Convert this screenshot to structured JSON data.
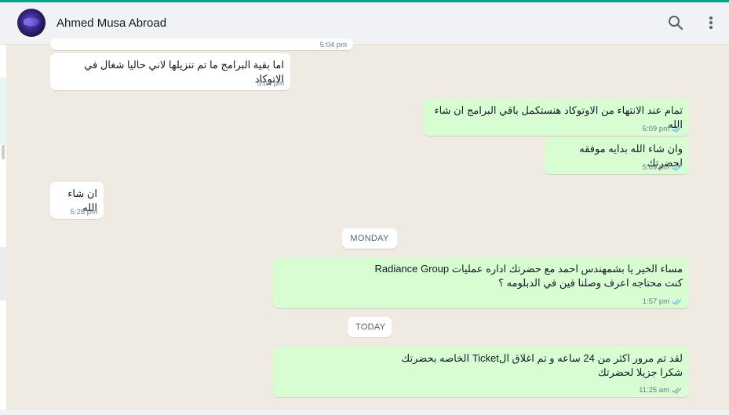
{
  "header": {
    "contact_name": "Ahmed Musa Abroad",
    "avatar_icon": "contact-avatar",
    "search_icon": "search-icon",
    "menu_icon": "more-vertical-icon"
  },
  "colors": {
    "accent": "#00a884",
    "incoming": "#ffffff",
    "outgoing": "#d9fdd3",
    "tick_read": "#53bdeb",
    "tick_sent": "#8696a0"
  },
  "messages": [
    {
      "direction": "in",
      "text": "",
      "time": "5:04 pm",
      "partial": true
    },
    {
      "direction": "in",
      "text": "اما بقية البرامج ما تم تنزيلها لاني حاليا شغال في الاتوكاد",
      "time": "5:04 pm"
    },
    {
      "direction": "out",
      "text": "تمام عند الانتهاء من الاوتوكاد هنستكمل باقي البرامج ان شاء الله",
      "time": "5:09 pm",
      "status": "read"
    },
    {
      "direction": "out",
      "text": "وان شاء الله بدايه موفقه لحضرتك",
      "time": "5:09 pm",
      "status": "read"
    },
    {
      "direction": "in",
      "text": "ان شاء الله",
      "time": "5:28 pm"
    },
    {
      "direction": "out",
      "text": "مساء  الخير يا بشمهندس احمد  مع حضرتك اداره عمليات Radiance Group\nكنت محتاجه اعرف وصلنا فين في الدبلومه  ؟",
      "time": "1:57 pm",
      "status": "read"
    },
    {
      "direction": "out",
      "text": "لقد تم مرور اكثر من  24 ساعه و تم اغلاق الTicket الخاصه بحضرتك\nشكرا جزيلا لحضرتك",
      "time": "11:25 am",
      "status": "delivered"
    }
  ],
  "date_separators": [
    "MONDAY",
    "TODAY"
  ]
}
